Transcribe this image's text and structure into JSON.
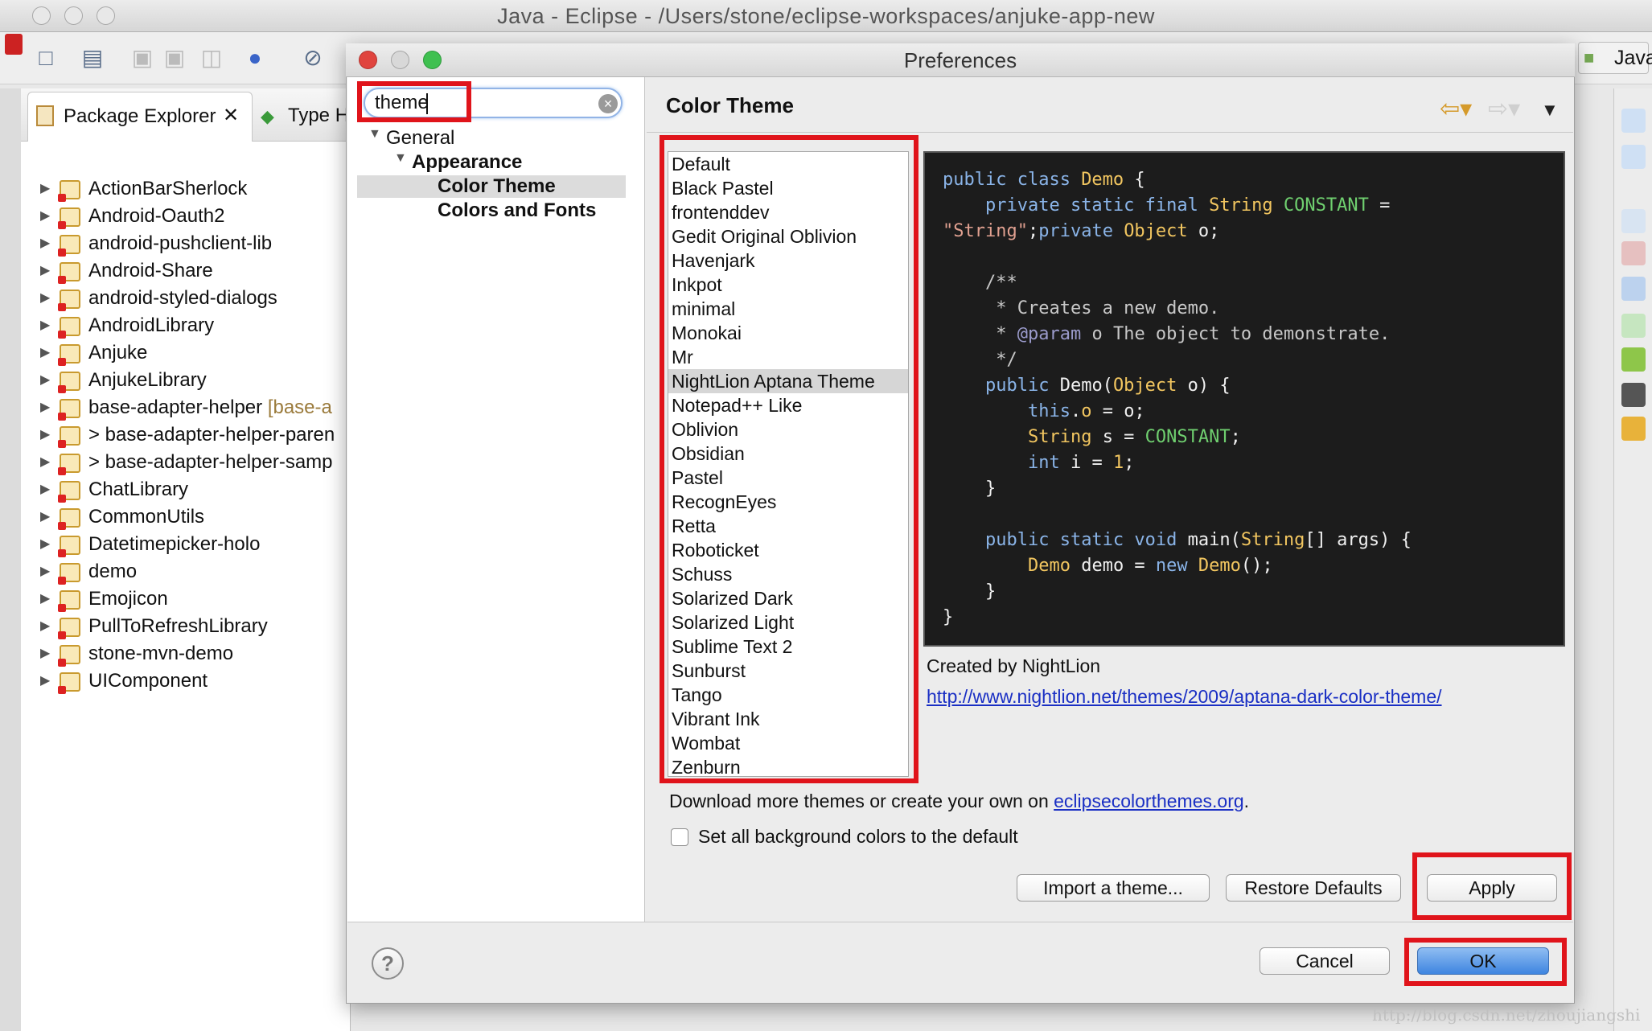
{
  "window": {
    "title": "Java - Eclipse - /Users/stone/eclipse-workspaces/anjuke-app-new"
  },
  "perspective": {
    "label": "Java"
  },
  "explorer": {
    "tab_label": "Package Explorer",
    "second_tab_label": "Type H",
    "projects": [
      {
        "name": "ActionBarSherlock",
        "extra": ""
      },
      {
        "name": "Android-Oauth2",
        "extra": ""
      },
      {
        "name": "android-pushclient-lib",
        "extra": ""
      },
      {
        "name": "Android-Share",
        "extra": ""
      },
      {
        "name": "android-styled-dialogs",
        "extra": ""
      },
      {
        "name": "AndroidLibrary",
        "extra": ""
      },
      {
        "name": "Anjuke",
        "extra": ""
      },
      {
        "name": "AnjukeLibrary",
        "extra": ""
      },
      {
        "name": "base-adapter-helper",
        "extra": "[base-a"
      },
      {
        "name": "> base-adapter-helper-paren",
        "extra": ""
      },
      {
        "name": "> base-adapter-helper-samp",
        "extra": ""
      },
      {
        "name": "ChatLibrary",
        "extra": ""
      },
      {
        "name": "CommonUtils",
        "extra": ""
      },
      {
        "name": "Datetimepicker-holo",
        "extra": ""
      },
      {
        "name": "demo",
        "extra": ""
      },
      {
        "name": "Emojicon",
        "extra": ""
      },
      {
        "name": "PullToRefreshLibrary",
        "extra": ""
      },
      {
        "name": "stone-mvn-demo",
        "extra": ""
      },
      {
        "name": "UIComponent",
        "extra": ""
      }
    ]
  },
  "dialog": {
    "title": "Preferences",
    "search_value": "theme",
    "nav": {
      "general": "General",
      "appearance": "Appearance",
      "color_theme": "Color Theme",
      "colors_fonts": "Colors and Fonts"
    },
    "page_title": "Color Theme",
    "themes": [
      "Default",
      "Black Pastel",
      "frontenddev",
      "Gedit Original Oblivion",
      "Havenjark",
      "Inkpot",
      "minimal",
      "Monokai",
      "Mr",
      "NightLion Aptana Theme",
      "Notepad++ Like",
      "Oblivion",
      "Obsidian",
      "Pastel",
      "RecognEyes",
      "Retta",
      "Roboticket",
      "Schuss",
      "Solarized Dark",
      "Solarized Light",
      "Sublime Text 2",
      "Sunburst",
      "Tango",
      "Vibrant Ink",
      "Wombat",
      "Zenburn"
    ],
    "selected_theme": "NightLion Aptana Theme",
    "preview_code": [
      "public class Demo {",
      "    private static final String CONSTANT =",
      "\"String\";private Object o;",
      "",
      "    /**",
      "     * Creates a new demo.",
      "     * @param o The object to demonstrate.",
      "     */",
      "    public Demo(Object o) {",
      "        this.o = o;",
      "        String s = CONSTANT;",
      "        int i = 1;",
      "    }",
      "",
      "    public static void main(String[] args) {",
      "        Demo demo = new Demo();",
      "    }",
      "}"
    ],
    "created_by": "Created by NightLion",
    "theme_url": "http://www.nightlion.net/themes/2009/aptana-dark-color-theme/",
    "download_text": "Download more themes or create your own on ",
    "download_link": "eclipsecolorthemes.org",
    "download_suffix": ".",
    "checkbox_label": "Set all background colors to the default",
    "checkbox_checked": false,
    "buttons": {
      "import": "Import a theme...",
      "restore": "Restore Defaults",
      "apply": "Apply",
      "cancel": "Cancel",
      "ok": "OK"
    }
  },
  "watermark": "http://blog.csdn.net/zhoujiangshi",
  "colors": {
    "highlight": "#e0141b",
    "ok_button": "#3e85e0",
    "link": "#1a2fc4"
  }
}
